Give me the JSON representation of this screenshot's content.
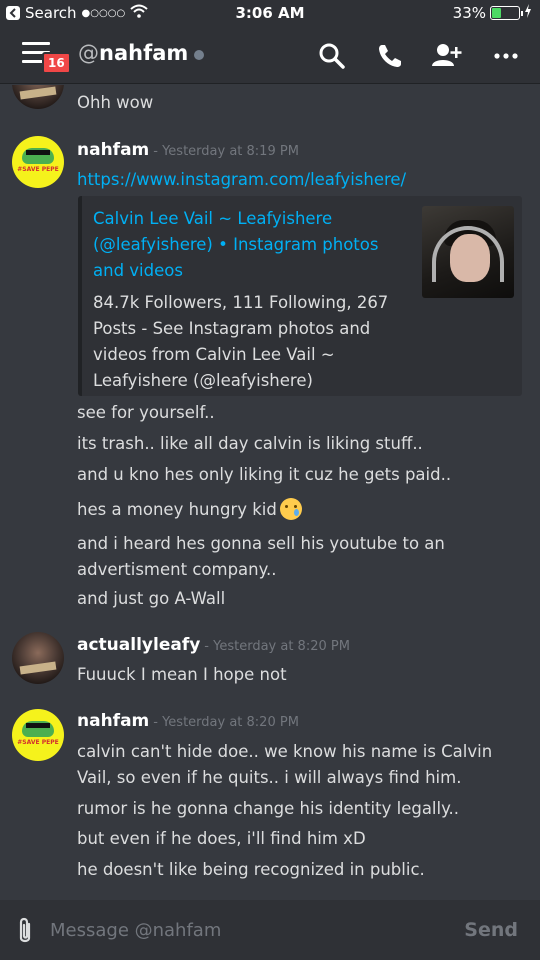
{
  "status_bar": {
    "back_label": "Search",
    "time": "3:06 AM",
    "battery": "33%",
    "battery_level": 0.33,
    "signal_dots": "●○○○○"
  },
  "header": {
    "badge": "16",
    "at": "@",
    "username": "nahfam"
  },
  "messages": [
    {
      "text": "Ohh wow"
    },
    {
      "author": "nahfam",
      "timestamp": "- Yesterday at 8:19 PM",
      "link": "https://www.instagram.com/leafyishere/",
      "embed": {
        "title": "Calvin Lee Vail ~ Leafyishere (@leafyishere) • Instagram photos and videos",
        "description": "84.7k Followers, 111 Following, 267 Posts - See Instagram photos and videos from Calvin Lee Vail ~ Leafyishere (@leafyishere)"
      },
      "lines": [
        "see for yourself..",
        "its trash.. like all day calvin is liking stuff..",
        "and u kno hes only liking it cuz he gets paid..",
        "hes a money hungry kid",
        "and i heard hes gonna sell his youtube to an advertisment company..",
        "and just go A-Wall"
      ]
    },
    {
      "author": "actuallyleafy",
      "timestamp": "- Yesterday at 8:20 PM",
      "lines": [
        "Fuuuck I mean I hope not"
      ]
    },
    {
      "author": "nahfam",
      "timestamp": "- Yesterday at 8:20 PM",
      "avatar_text": "#SAVE PEPE",
      "lines": [
        "calvin can't hide doe.. we know his name is Calvin Vail, so even if he quits.. i will always find him.",
        "rumor is he gonna change his identity legally..",
        "but even if he does, i'll find him xD",
        "he doesn't like being recognized in public."
      ]
    }
  ],
  "composer": {
    "placeholder": "Message @nahfam",
    "send_label": "Send"
  },
  "colors": {
    "background": "#36393f",
    "header": "#2f3136",
    "link": "#00b0f4",
    "badge": "#f04747",
    "battery": "#4cd964"
  },
  "icons": [
    "back-icon",
    "wifi-icon",
    "battery-icon",
    "charging-icon",
    "menu-icon",
    "search-icon",
    "phone-icon",
    "add-user-icon",
    "more-icon",
    "paperclip-icon",
    "crying-emoji"
  ]
}
